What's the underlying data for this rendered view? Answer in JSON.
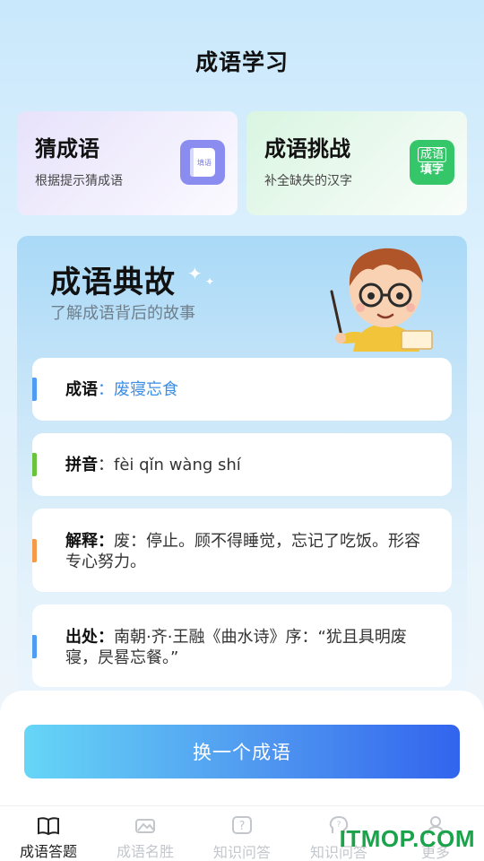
{
  "header": {
    "title": "成语学习"
  },
  "cards": [
    {
      "title": "猜成语",
      "subtitle": "根据提示猜成语",
      "icon": "book-icon",
      "icon_text": "填语"
    },
    {
      "title": "成语挑战",
      "subtitle": "补全缺失的汉字",
      "icon": "idiom-fill-icon",
      "icon_line1": "成语",
      "icon_line2": "填字"
    }
  ],
  "story": {
    "title": "成语典故",
    "subtitle": "了解成语背后的故事",
    "idiom_label": "成语",
    "idiom_value": "废寝忘食",
    "pinyin_label": "拼音",
    "pinyin_value": "fèi qǐn wàng shí",
    "meaning_label": "解释",
    "meaning_value": "废：停止。顾不得睡觉，忘记了吃饭。形容专心努力。",
    "source_label": "出处",
    "source_value": "南朝·齐·王融《曲水诗》序：“犹且具明废寝，昃晷忘餐。”"
  },
  "actions": {
    "next_idiom": "换一个成语"
  },
  "tabs": [
    {
      "label": "成语答题",
      "icon": "open-book-icon",
      "active": true
    },
    {
      "label": "成语名胜",
      "icon": "landscape-icon",
      "active": false
    },
    {
      "label": "知识问答",
      "icon": "question-icon",
      "active": false
    },
    {
      "label": "知识问答",
      "icon": "brain-icon",
      "active": false
    },
    {
      "label": "更多",
      "icon": "user-icon",
      "active": false
    }
  ],
  "watermark": "ITMOP.COM",
  "colors": {
    "accent": "#4f97f0",
    "green": "#35c66a",
    "purple": "#8a8cf0"
  }
}
